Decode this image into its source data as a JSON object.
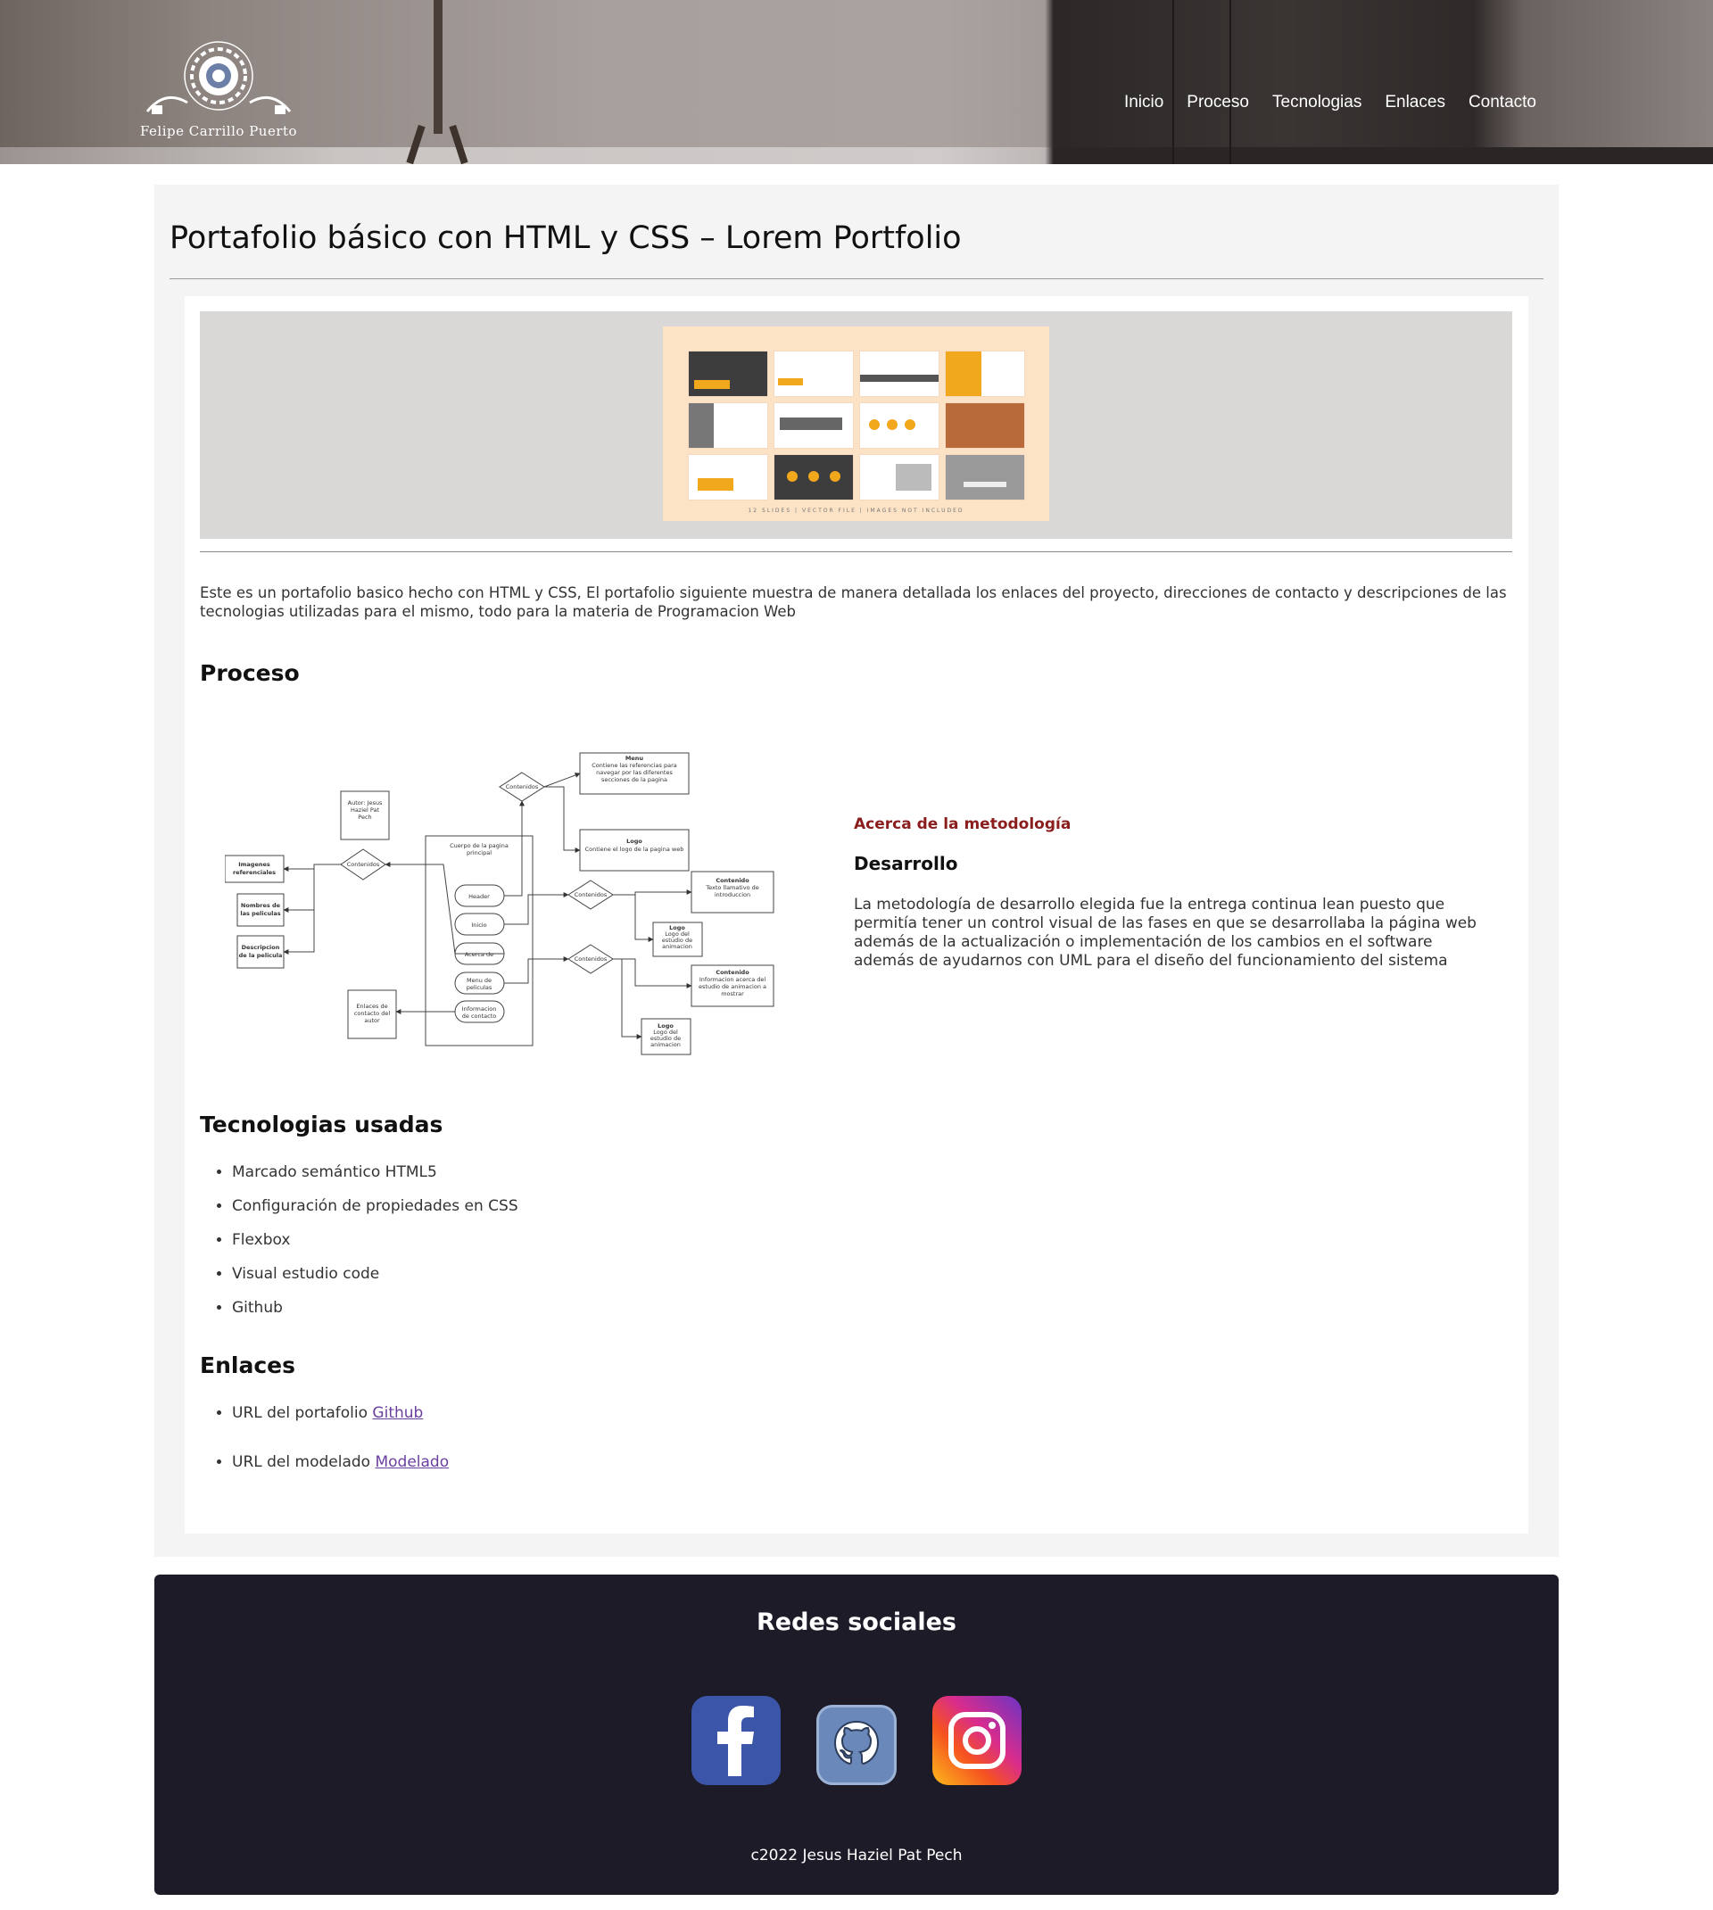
{
  "header": {
    "logo_text": "Felipe Carrillo Puerto",
    "nav": [
      "Inicio",
      "Proceso",
      "Tecnologias",
      "Enlaces",
      "Contacto"
    ]
  },
  "main": {
    "title": "Portafolio básico con HTML y CSS – Lorem Portfolio",
    "image_caption": "12 SLIDES | VECTOR FILE | IMAGES NOT INCLUDED",
    "intro": "Este es un portafolio basico hecho con HTML y CSS, El portafolio siguiente muestra de manera detallada los enlaces del proyecto, direcciones de contacto y descripciones de las tecnologias utilizadas para el mismo, todo para la materia de Programacion Web",
    "process": {
      "heading": "Proceso",
      "diagram": {
        "author": [
          "Autor: Jesus",
          "Haziel Pat",
          "Pech"
        ],
        "body": [
          "Cuerpo de la pagina",
          "principal"
        ],
        "pills": [
          "Header",
          "Inicio",
          "Acerca de",
          "Menu de",
          "peliculas",
          "Informacion",
          "de contacto"
        ],
        "contenidos": "Contenidos",
        "menu": [
          "Menu",
          "Contiene las referencias para",
          "navegar por las diferentes",
          "secciones de la pagina"
        ],
        "logo_top": [
          "Logo",
          "Contiene el logo de la pagina web"
        ],
        "contenido1": [
          "Contenido",
          "Texto llamativo de",
          "introduccion"
        ],
        "logo2": [
          "Logo",
          "Logo del",
          "estudio de",
          "animacion"
        ],
        "contenido2": [
          "Contenido",
          "Informacion acerca del",
          "estudio de animacion a",
          "mostrar"
        ],
        "logo3": [
          "Logo",
          "Logo del",
          "estudio de",
          "animacion"
        ],
        "left_boxes": [
          [
            "Imagenes",
            "referenciales"
          ],
          [
            "Nombres de",
            "las peliculas"
          ],
          [
            "Descripcion",
            "de la pelicula"
          ]
        ],
        "enlaces": [
          "Enlaces de",
          "contacto del",
          "autor"
        ]
      },
      "method_link": "Acerca de la metodología",
      "dev_heading": "Desarrollo",
      "dev_text": "La metodología de desarrollo elegida fue la entrega continua lean puesto que permitía tener un control visual de las fases en que se desarrollaba la página web además de la actualización o implementación de los cambios en el software además de ayudarnos con UML para el diseño del funcionamiento del sistema"
    },
    "tech": {
      "heading": "Tecnologias usadas",
      "items": [
        "Marcado semántico HTML5",
        "Configuración de propiedades en CSS",
        "Flexbox",
        "Visual estudio code",
        "Github"
      ]
    },
    "links": {
      "heading": "Enlaces",
      "items": [
        {
          "text": "URL del portafolio ",
          "link": "Github"
        },
        {
          "text": "URL del modelado ",
          "link": "Modelado"
        }
      ]
    }
  },
  "footer": {
    "title": "Redes sociales",
    "icons": [
      "facebook-icon",
      "github-icon",
      "instagram-icon"
    ],
    "copyright": "c2022 Jesus Haziel Pat Pech"
  }
}
